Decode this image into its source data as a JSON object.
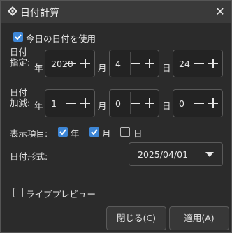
{
  "window": {
    "title": "日付計算",
    "close_glyph": "✕"
  },
  "use_today": {
    "label": "今日の日付を使用",
    "checked": true
  },
  "date_spec": {
    "label": "日付指定:",
    "year": {
      "value": "2020",
      "unit": "年"
    },
    "month": {
      "value": "4",
      "unit": "月"
    },
    "day": {
      "value": "24",
      "unit": "日"
    }
  },
  "date_add": {
    "label": "日付加減:",
    "year": {
      "value": "1",
      "unit": "年"
    },
    "month": {
      "value": "0",
      "unit": "月"
    },
    "day": {
      "value": "0",
      "unit": "日"
    }
  },
  "display_items": {
    "label": "表示項目:",
    "year": {
      "label": "年",
      "checked": true
    },
    "month": {
      "label": "月",
      "checked": true
    },
    "day": {
      "label": "日",
      "checked": false
    }
  },
  "date_format": {
    "label": "日付形式:",
    "value": "2025/04/01"
  },
  "live_preview": {
    "label": "ライブプレビュー",
    "checked": false
  },
  "buttons": {
    "close": "閉じる(C)",
    "apply": "適用(A)"
  },
  "colors": {
    "accent": "#3d86d6",
    "bg": "#2b2b2b"
  }
}
